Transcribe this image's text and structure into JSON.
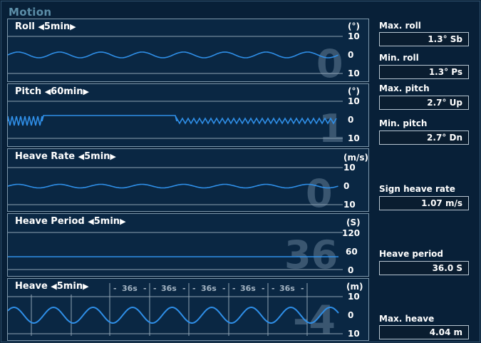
{
  "header": {
    "title": "Motion"
  },
  "panels": [
    {
      "id": "roll",
      "title": "Roll",
      "period": "5min",
      "unit": "(°)",
      "top_tick": "10",
      "mid_tick": "0",
      "bottom_tick": "10",
      "big_value": "0"
    },
    {
      "id": "pitch",
      "title": "Pitch",
      "period": "60min",
      "unit": "(°)",
      "top_tick": "10",
      "mid_tick": "0",
      "bottom_tick": "10",
      "big_value": "1"
    },
    {
      "id": "heave-rate",
      "title": "Heave Rate",
      "period": "5min",
      "unit": "(m/s)",
      "top_tick": "10",
      "mid_tick": "0",
      "bottom_tick": "10",
      "big_value": "0"
    },
    {
      "id": "heave-period",
      "title": "Heave Period",
      "period": "5min",
      "unit": "(S)",
      "top_tick": "120",
      "mid_tick": "60",
      "bottom_tick": "0",
      "big_value": "36"
    },
    {
      "id": "heave",
      "title": "Heave",
      "period": "5min",
      "unit": "(m)",
      "top_tick": "10",
      "mid_tick": "0",
      "bottom_tick": "10",
      "big_value": "4",
      "period_markers": [
        "36s",
        "36s",
        "36s",
        "36s",
        "36s"
      ]
    }
  ],
  "arrows": {
    "left": "◀",
    "right": "▶"
  },
  "readouts": {
    "max_roll": {
      "label": "Max. roll",
      "value": "1.3° Sb"
    },
    "min_roll": {
      "label": "Min. roll",
      "value": "1.3° Ps"
    },
    "max_pitch": {
      "label": "Max. pitch",
      "value": "2.7° Up"
    },
    "min_pitch": {
      "label": "Min. pitch",
      "value": "2.7° Dn"
    },
    "sign_heave_rate": {
      "label": "Sign heave rate",
      "value": "1.07 m/s"
    },
    "heave_period": {
      "label": "Heave period",
      "value": "36.0 S"
    },
    "max_heave": {
      "label": "Max. heave",
      "value": "4.04 m"
    }
  },
  "colors": {
    "trace": "#2f8fe8",
    "panel_border": "#7e98ac",
    "background": "#082038",
    "big_value": "#3a5670"
  }
}
